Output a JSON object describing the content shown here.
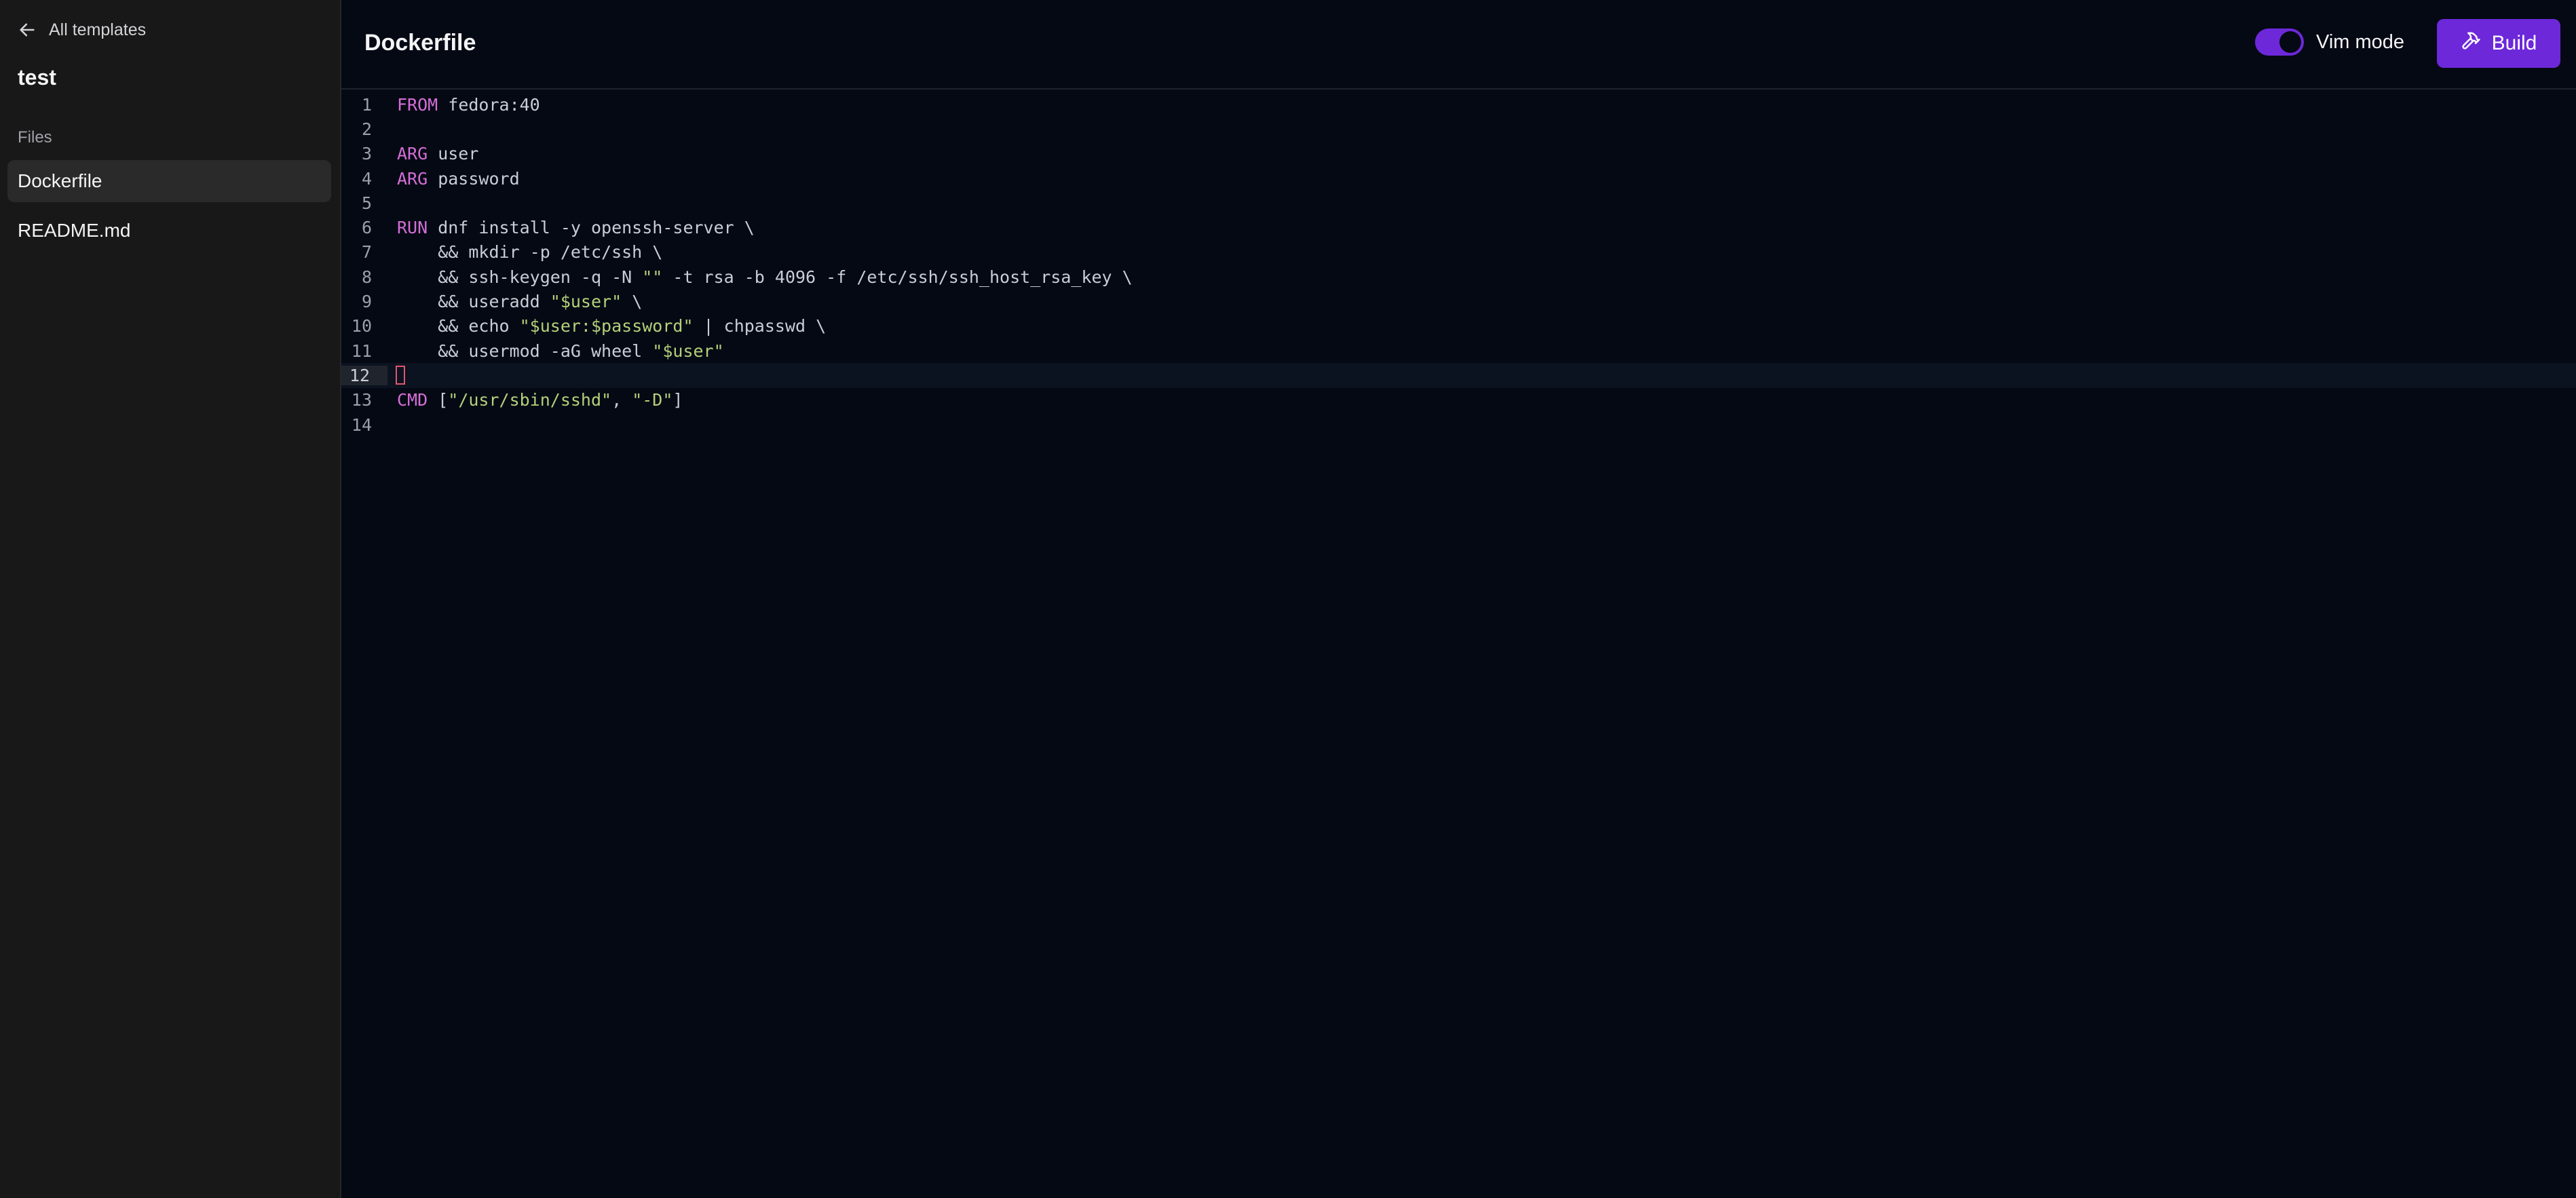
{
  "sidebar": {
    "back_label": "All templates",
    "project_name": "test",
    "files_label": "Files",
    "files": [
      {
        "name": "Dockerfile",
        "active": true
      },
      {
        "name": "README.md",
        "active": false
      }
    ]
  },
  "header": {
    "title": "Dockerfile",
    "vim_mode_label": "Vim mode",
    "vim_mode_enabled": true,
    "build_label": "Build"
  },
  "editor": {
    "current_line": 12,
    "lines": [
      {
        "n": "1",
        "tokens": [
          {
            "t": "FROM",
            "c": "kw"
          },
          {
            "t": " fedora:40",
            "c": ""
          }
        ]
      },
      {
        "n": "2",
        "tokens": []
      },
      {
        "n": "3",
        "tokens": [
          {
            "t": "ARG",
            "c": "kw"
          },
          {
            "t": " user",
            "c": ""
          }
        ]
      },
      {
        "n": "4",
        "tokens": [
          {
            "t": "ARG",
            "c": "kw"
          },
          {
            "t": " password",
            "c": ""
          }
        ]
      },
      {
        "n": "5",
        "tokens": []
      },
      {
        "n": "6",
        "tokens": [
          {
            "t": "RUN",
            "c": "kw"
          },
          {
            "t": " dnf install -y openssh-server \\",
            "c": ""
          }
        ]
      },
      {
        "n": "7",
        "tokens": [
          {
            "t": "    && mkdir -p /etc/ssh \\",
            "c": ""
          }
        ]
      },
      {
        "n": "8",
        "tokens": [
          {
            "t": "    && ssh-keygen -q -N ",
            "c": ""
          },
          {
            "t": "\"\"",
            "c": "str"
          },
          {
            "t": " -t rsa -b 4096 -f /etc/ssh/ssh_host_rsa_key \\",
            "c": ""
          }
        ]
      },
      {
        "n": "9",
        "tokens": [
          {
            "t": "    && useradd ",
            "c": ""
          },
          {
            "t": "\"$user\"",
            "c": "str"
          },
          {
            "t": " \\",
            "c": ""
          }
        ]
      },
      {
        "n": "10",
        "tokens": [
          {
            "t": "    && echo ",
            "c": ""
          },
          {
            "t": "\"$user:$password\"",
            "c": "str"
          },
          {
            "t": " | chpasswd \\",
            "c": ""
          }
        ]
      },
      {
        "n": "11",
        "tokens": [
          {
            "t": "    && usermod -aG wheel ",
            "c": ""
          },
          {
            "t": "\"$user\"",
            "c": "str"
          }
        ]
      },
      {
        "n": "12",
        "tokens": []
      },
      {
        "n": "13",
        "tokens": [
          {
            "t": "CMD",
            "c": "kw"
          },
          {
            "t": " [",
            "c": ""
          },
          {
            "t": "\"/usr/sbin/sshd\"",
            "c": "str"
          },
          {
            "t": ", ",
            "c": ""
          },
          {
            "t": "\"-D\"",
            "c": "str"
          },
          {
            "t": "]",
            "c": ""
          }
        ]
      },
      {
        "n": "14",
        "tokens": []
      }
    ]
  },
  "colors": {
    "accent": "#6d28d9",
    "keyword": "#d46ed6",
    "string": "#b5d07a",
    "cursor": "#e0566f"
  }
}
